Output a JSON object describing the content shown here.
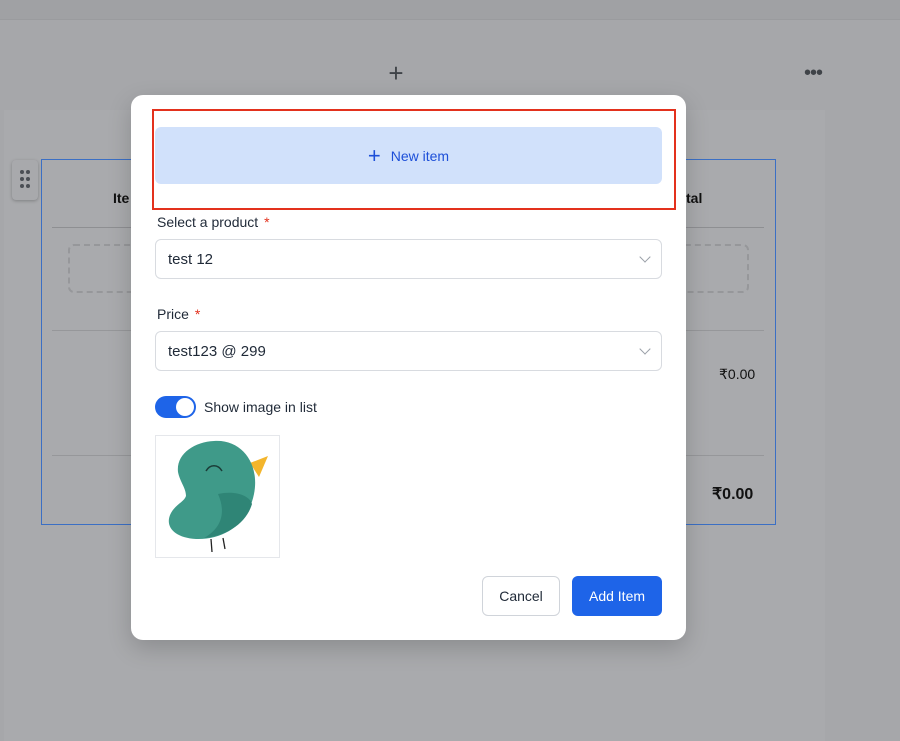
{
  "background": {
    "add_icon": "plus-icon",
    "more_icon": "more-horizontal-icon",
    "table_header_left": "Ite",
    "table_header_right": "tal",
    "row_amount": "₹0.00",
    "total_amount": "₹0.00"
  },
  "modal": {
    "new_item_label": "New item",
    "select_product": {
      "label": "Select a product",
      "required_mark": "*",
      "value": "test 12"
    },
    "price": {
      "label": "Price",
      "required_mark": "*",
      "value": "test123 @ 299"
    },
    "show_image": {
      "label": "Show image in list",
      "enabled": true
    },
    "cancel_label": "Cancel",
    "add_label": "Add Item"
  },
  "colors": {
    "primary": "#1e64e8",
    "highlight": "#e3311d",
    "new_item_bg": "#d1e1fb",
    "bird": "#3f9a89",
    "beak": "#f3b52c"
  }
}
